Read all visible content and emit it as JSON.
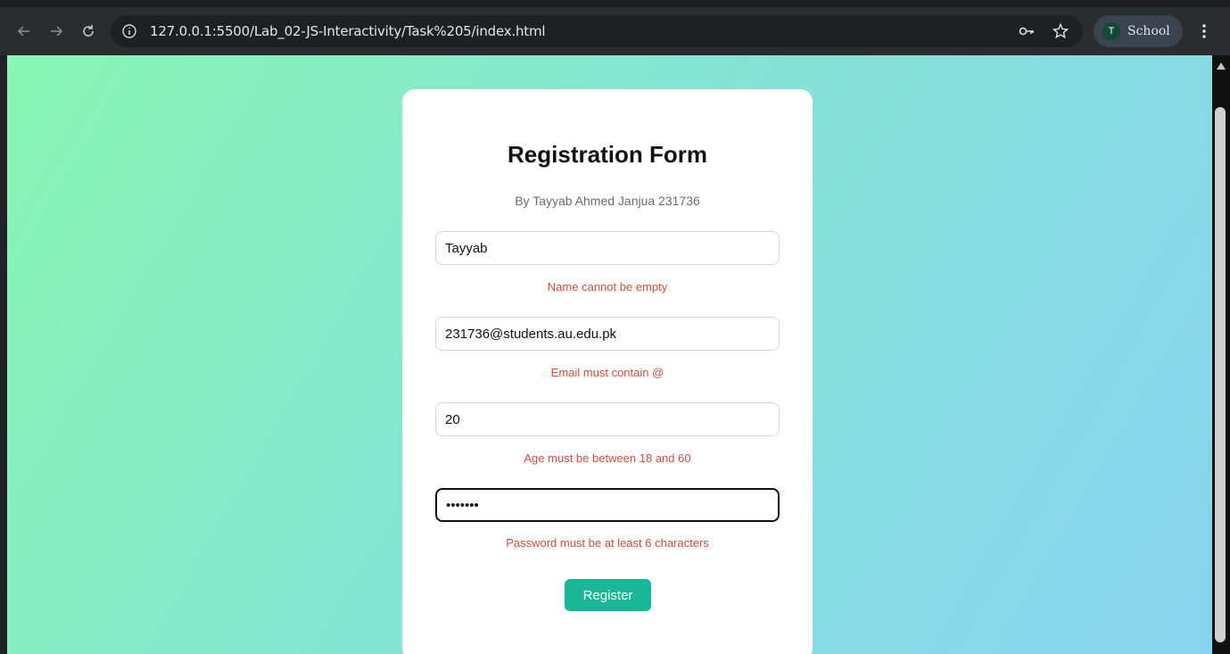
{
  "browser": {
    "url": "127.0.0.1:5500/Lab_02-JS-Interactivity/Task%205/index.html",
    "profile_initial": "T",
    "profile_name": "School"
  },
  "icons": {
    "back": "arrow-left-icon",
    "forward": "arrow-right-icon",
    "reload": "reload-icon",
    "site_info": "info-icon",
    "password": "key-icon",
    "bookmark": "star-icon",
    "menu": "vertical-dots-icon"
  },
  "form": {
    "title": "Registration Form",
    "subtitle": "By Tayyab Ahmed Janjua 231736",
    "name_value": "Tayyab",
    "name_error": "Name cannot be empty",
    "email_value": "231736@students.au.edu.pk",
    "email_error": "Email must contain @",
    "age_value": "20",
    "age_error": "Age must be between 18 and 60",
    "password_value": "•••••••",
    "password_error": "Password must be at least 6 characters",
    "submit_label": "Register"
  },
  "colors": {
    "button": "#19b797",
    "error": "#d44b3d",
    "background_start": "#8af5b4",
    "background_end": "#88d3ef"
  }
}
